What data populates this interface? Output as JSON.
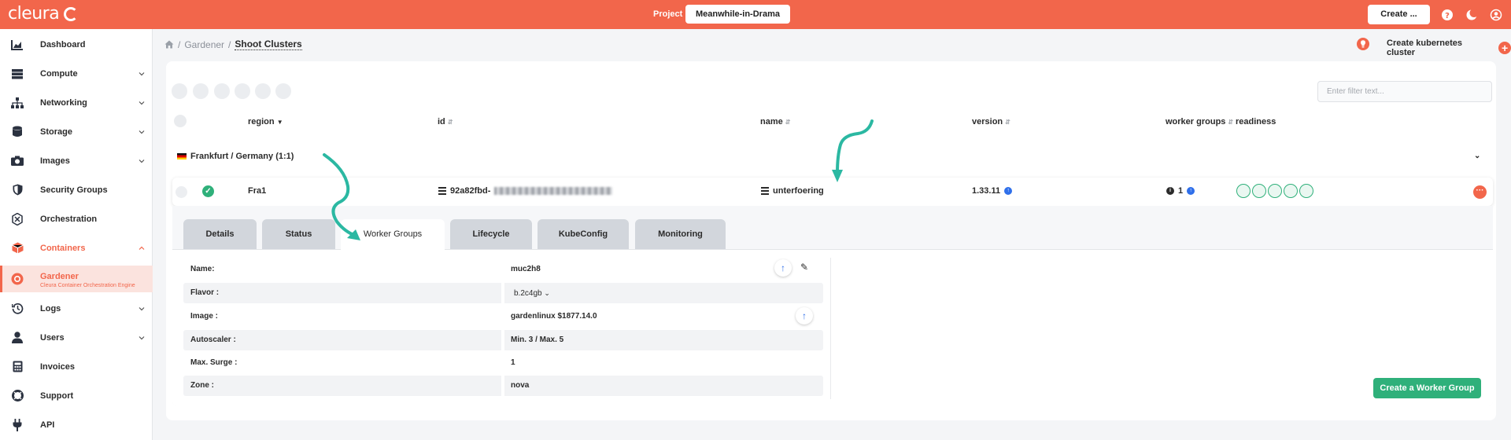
{
  "topbar": {
    "logo": "cleura",
    "project_label": "Project",
    "project_name": "Meanwhile-in-Drama",
    "create_label": "Create ...",
    "icons": [
      "help-icon",
      "moon-icon",
      "user-icon"
    ]
  },
  "sidebar": {
    "items": [
      {
        "label": "Dashboard",
        "icon": "chart-icon"
      },
      {
        "label": "Compute",
        "icon": "server-icon"
      },
      {
        "label": "Networking",
        "icon": "network-icon"
      },
      {
        "label": "Storage",
        "icon": "database-icon"
      },
      {
        "label": "Images",
        "icon": "camera-icon"
      },
      {
        "label": "Security Groups",
        "icon": "shield-icon"
      },
      {
        "label": "Orchestration",
        "icon": "orchestration-icon"
      },
      {
        "label": "Containers",
        "icon": "box-icon"
      },
      {
        "label": "Gardener",
        "sub": "Cleura Container Orchestration Engine",
        "icon": "gardener-icon"
      },
      {
        "label": "Logs",
        "icon": "history-icon"
      },
      {
        "label": "Users",
        "icon": "user-icon"
      },
      {
        "label": "Invoices",
        "icon": "calculator-icon"
      },
      {
        "label": "Support",
        "icon": "lifebuoy-icon"
      },
      {
        "label": "API",
        "icon": "plug-icon"
      }
    ]
  },
  "breadcrumb": {
    "sep": "/",
    "parent": "Gardener",
    "current": "Shoot Clusters"
  },
  "header": {
    "create_cluster": "Create kubernetes cluster"
  },
  "filter": {
    "placeholder": "Enter filter text..."
  },
  "table": {
    "columns": {
      "region": "region",
      "id": "id",
      "name": "name",
      "version": "version",
      "worker_groups": "worker groups",
      "readiness": "readiness"
    },
    "group": "Frankfurt / Germany (1:1)",
    "row": {
      "region": "Fra1",
      "id_prefix": "92a82fbd-",
      "name": "unterfoering",
      "version": "1.33.11",
      "worker_groups": "1"
    }
  },
  "tabs": [
    "Details",
    "Status",
    "Worker Groups",
    "Lifecycle",
    "KubeConfig",
    "Monitoring"
  ],
  "worker_group": {
    "fields": [
      {
        "label": "Name:",
        "value": "muc2h8"
      },
      {
        "label": "Flavor :",
        "value": "b.2c4gb"
      },
      {
        "label": "Image :",
        "value": "gardenlinux $1877.14.0"
      },
      {
        "label": "Autoscaler :",
        "value": "Min. 3 / Max. 5"
      },
      {
        "label": "Max. Surge :",
        "value": "1"
      },
      {
        "label": "Zone :",
        "value": "nova"
      }
    ],
    "create_button": "Create a Worker Group"
  },
  "colors": {
    "brand": "#f2664b",
    "success": "#2fb07a",
    "info": "#2f6fea",
    "annotation": "#2bb8a2"
  }
}
